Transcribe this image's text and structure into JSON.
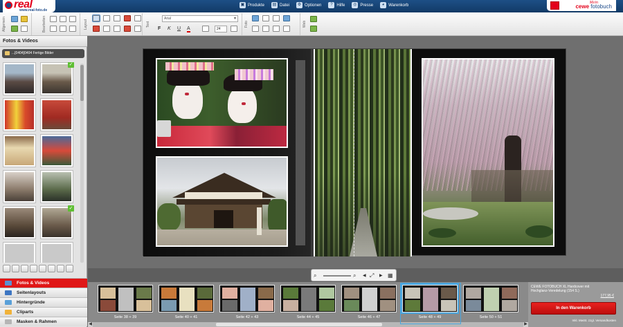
{
  "header": {
    "brand": "real",
    "brand_url": "www.real-foto.de",
    "nav": [
      {
        "label": "Produkte",
        "icon": "products-icon",
        "glyph": "▣"
      },
      {
        "label": "Datei",
        "icon": "file-icon",
        "glyph": "▤"
      },
      {
        "label": "Optionen",
        "icon": "options-icon",
        "glyph": "⚙"
      },
      {
        "label": "Hilfe",
        "icon": "help-icon",
        "glyph": "?"
      },
      {
        "label": "Presse",
        "icon": "press-icon",
        "glyph": "◎"
      },
      {
        "label": "Warenkorb",
        "icon": "cart-icon",
        "glyph": "◕"
      }
    ],
    "partner_prefix": "Mein",
    "partner_name": "cewe",
    "partner_product": "fotobuch"
  },
  "toolbar": {
    "groups": [
      "Allgemein",
      "Bearbeiten",
      "Layout",
      "Text",
      "Foto",
      "Web"
    ],
    "font_value": "Arial",
    "size_value": "24",
    "bold": "F",
    "italic": "K",
    "underline": "U",
    "color": "A"
  },
  "left_panel": {
    "title": "Fotos & Videos",
    "folder_path": "...[0404]0404 Fertige Bilder",
    "check_glyph": "✓",
    "menu": [
      {
        "label": "Fotos & Videos",
        "active": true,
        "icon": "photos-icon",
        "color": "#5b8fd0"
      },
      {
        "label": "Seitenlayouts",
        "active": false,
        "icon": "layouts-icon",
        "color": "#3d76c2"
      },
      {
        "label": "Hintergründe",
        "active": false,
        "icon": "backgrounds-icon",
        "color": "#5aa0d8"
      },
      {
        "label": "Cliparts",
        "active": false,
        "icon": "cliparts-icon",
        "color": "#f0b23a"
      },
      {
        "label": "Masken & Rahmen",
        "active": false,
        "icon": "masks-frames-icon",
        "color": "#b5b5b5"
      }
    ]
  },
  "filmstrip": {
    "spreads": [
      {
        "label": "Seite 38 + 39",
        "selected": false
      },
      {
        "label": "Seite 40 + 41",
        "selected": false
      },
      {
        "label": "Seite 42 + 43",
        "selected": false
      },
      {
        "label": "Seite 44 + 45",
        "selected": false
      },
      {
        "label": "Seite 46 + 47",
        "selected": false
      },
      {
        "label": "Seite 48 + 49",
        "selected": true
      },
      {
        "label": "Seite 50 + 51",
        "selected": false
      }
    ],
    "arrow_left": "◀",
    "arrow_right": "▶"
  },
  "zoom": {
    "zoom_out": "⌕",
    "zoom_in": "⌕",
    "prev": "◀",
    "fit": "⤢",
    "next": "▶",
    "grid": "▦"
  },
  "order": {
    "description": "CEWE FOTOBUCH XL Hardcover mit Hochglanz-Veredelung (154 S.)",
    "price": "177,95 €",
    "button": "In den Warenkorb",
    "note": "Inkl. MwSt. zzgl. Versandkosten"
  },
  "colors": {
    "accent_red": "#e01717",
    "header_blue": "#1d4f86",
    "selection_blue": "#4aa6de"
  }
}
